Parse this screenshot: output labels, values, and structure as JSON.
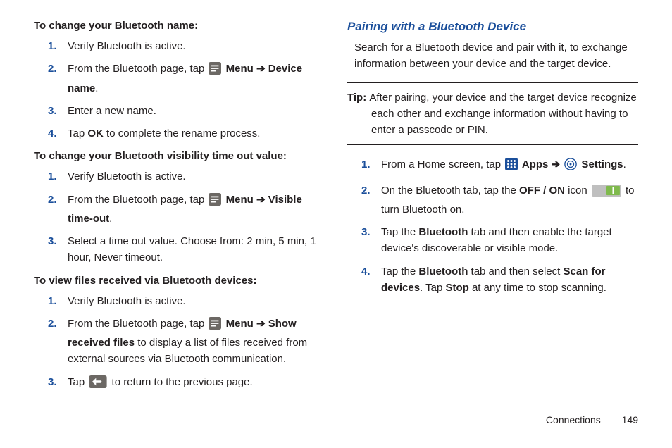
{
  "left": {
    "h1": "To change your Bluetooth name:",
    "l1": {
      "s1": "Verify Bluetooth is active.",
      "s2a": "From the Bluetooth page, tap ",
      "s2b": " Menu ",
      "s2c": " Device name",
      "s2d": ".",
      "s3": "Enter a new name.",
      "s4a": "Tap ",
      "s4b": "OK",
      "s4c": " to complete the rename process."
    },
    "h2": "To change your Bluetooth visibility time out value:",
    "l2": {
      "s1": "Verify Bluetooth is active.",
      "s2a": "From the Bluetooth page, tap ",
      "s2b": " Menu ",
      "s2c": " Visible time-out",
      "s2d": ".",
      "s3": "Select a time out value. Choose from: 2 min, 5 min, 1 hour, Never timeout."
    },
    "h3": "To view files received via Bluetooth devices:",
    "l3": {
      "s1": "Verify Bluetooth is active.",
      "s2a": "From the Bluetooth page, tap ",
      "s2b": " Menu ",
      "s2c": " Show received files",
      "s2d": " to display a list of files received from external sources via Bluetooth communication.",
      "s3a": "Tap ",
      "s3b": " to return to the previous page."
    }
  },
  "right": {
    "title": "Pairing with a Bluetooth Device",
    "intro": "Search for a Bluetooth device and pair with it, to exchange information between your device and the target device.",
    "tip_label": "Tip: ",
    "tip_text": "After pairing, your device and the target device recognize each other and exchange information without having to enter a passcode or PIN.",
    "l1": {
      "s1a": "From a Home screen, tap ",
      "s1b": " Apps ",
      "s1c": " Settings",
      "s1d": ".",
      "s2a": "On the Bluetooth tab, tap the ",
      "s2b": "OFF / ON",
      "s2c": " icon ",
      "s2d": " to turn Bluetooth on.",
      "s3a": "Tap the ",
      "s3b": "Bluetooth",
      "s3c": " tab and then enable the target device's discoverable or visible mode.",
      "s4a": "Tap the ",
      "s4b": "Bluetooth",
      "s4c": " tab and then select ",
      "s4d": "Scan for devices",
      "s4e": ". Tap ",
      "s4f": "Stop",
      "s4g": " at any time to stop scanning."
    }
  },
  "footer": {
    "chapter": "Connections",
    "page": "149"
  },
  "nums": {
    "n1": "1.",
    "n2": "2.",
    "n3": "3.",
    "n4": "4."
  },
  "arrow": "➔"
}
